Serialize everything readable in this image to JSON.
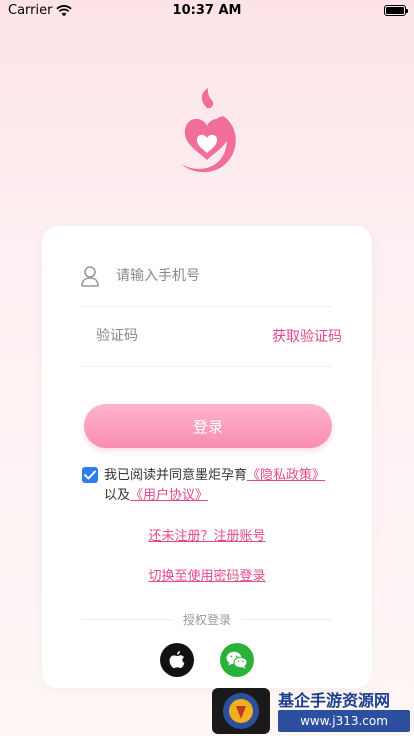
{
  "status_bar": {
    "carrier": "Carrier",
    "time": "10:37 AM"
  },
  "login": {
    "phone_placeholder": "请输入手机号",
    "code_placeholder": "验证码",
    "get_code_label": "获取验证码",
    "login_button": "登录",
    "agreement": {
      "checked": true,
      "prefix": "我已阅读并同意墨炬孕育",
      "privacy_link": "《隐私政策》",
      "join_text": "以及",
      "user_agreement_link": "《用户协议》"
    },
    "register_link": "还未注册？注册账号",
    "switch_link": "切换至使用密码登录",
    "auth_label": "授权登录",
    "social": [
      {
        "name": "apple",
        "icon": "apple-icon"
      },
      {
        "name": "wechat",
        "icon": "wechat-icon"
      }
    ]
  },
  "watermark": {
    "title": "基企手游资源网",
    "url": "www.j313.com"
  },
  "colors": {
    "accent": "#e5488a",
    "button_top": "#ffb3cd",
    "button_bottom": "#f78db0",
    "checkbox": "#2f7df6",
    "wechat": "#2bb13a"
  }
}
